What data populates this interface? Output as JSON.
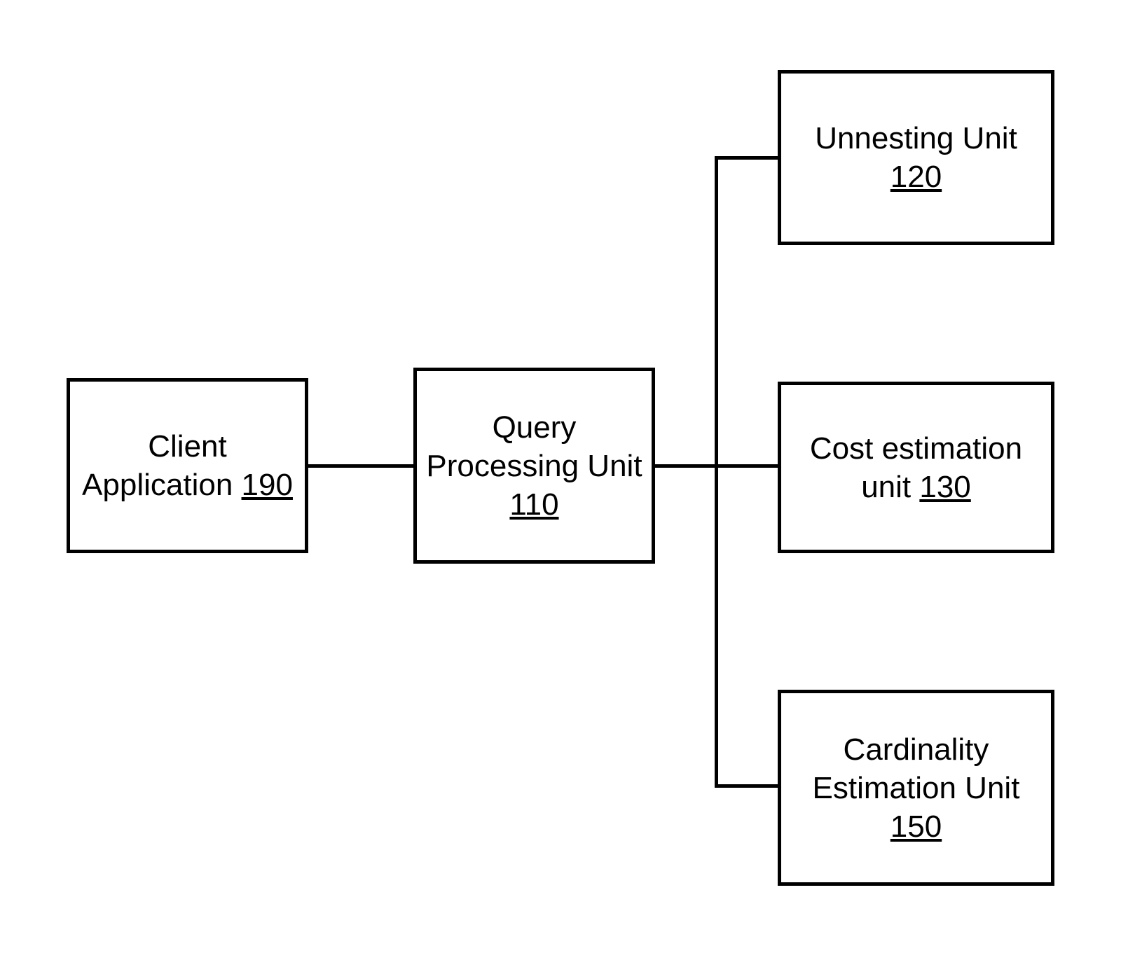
{
  "boxes": {
    "client": {
      "line1": "Client",
      "line2_prefix": "Application ",
      "num": "190"
    },
    "qpu": {
      "line1": "Query",
      "line2": "Processing Unit",
      "num": "110"
    },
    "unnest": {
      "line1": "Unnesting Unit",
      "num": "120"
    },
    "cost": {
      "line1": "Cost estimation",
      "line2_prefix": "unit ",
      "num": "130"
    },
    "card": {
      "line1": "Cardinality",
      "line2": "Estimation Unit",
      "num": "150"
    }
  }
}
